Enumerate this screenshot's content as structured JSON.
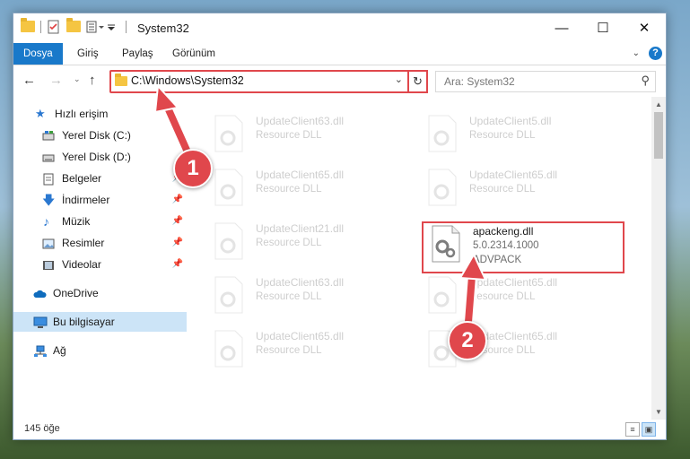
{
  "window": {
    "title": "System32",
    "controls": {
      "minimize": "—",
      "maximize": "☐",
      "close": "✕"
    }
  },
  "ribbon": {
    "tabs": [
      "Dosya",
      "Giriş",
      "Paylaş",
      "Görünüm"
    ],
    "expand_icon": "chevron-down-icon",
    "help_label": "?"
  },
  "navigation": {
    "address_path": "C:\\Windows\\System32",
    "search_placeholder": "Ara: System32"
  },
  "sidebar": {
    "items": [
      {
        "label": "Hızlı erişim",
        "icon": "star-icon"
      },
      {
        "label": "Yerel Disk (C:)",
        "icon": "drive-icon"
      },
      {
        "label": "Yerel Disk (D:)",
        "icon": "drive-icon"
      },
      {
        "label": "Belgeler",
        "icon": "documents-icon",
        "pinned": true
      },
      {
        "label": "İndirmeler",
        "icon": "download-icon",
        "pinned": true
      },
      {
        "label": "Müzik",
        "icon": "music-icon",
        "pinned": true
      },
      {
        "label": "Resimler",
        "icon": "pictures-icon",
        "pinned": true
      },
      {
        "label": "Videolar",
        "icon": "videos-icon",
        "pinned": true
      },
      {
        "label": "OneDrive",
        "icon": "cloud-icon"
      },
      {
        "label": "Bu bilgisayar",
        "icon": "computer-icon",
        "selected": true
      },
      {
        "label": "Ağ",
        "icon": "network-icon"
      }
    ]
  },
  "files": [
    {
      "name": "UpdateClient63.dll",
      "type": "Resource DLL",
      "faded": true
    },
    {
      "name": "UpdateClient5.dll",
      "type": "Resource DLL",
      "faded": true
    },
    {
      "name": "UpdateClient65.dll",
      "type": "Resource DLL",
      "faded": true
    },
    {
      "name": "UpdateClient65.dll",
      "type": "Resource DLL",
      "faded": true
    },
    {
      "name": "UpdateClient21.dll",
      "type": "Resource DLL",
      "faded": true
    },
    {
      "name": "apackeng.dll",
      "version": "5.0.2314.1000",
      "type": "ADVPACK",
      "faded": false
    },
    {
      "name": "UpdateClient63.dll",
      "type": "Resource DLL",
      "faded": true
    },
    {
      "name": "UpdateClient65.dll",
      "type": "Resource DLL",
      "faded": true
    },
    {
      "name": "UpdateClient65.dll",
      "type": "Resource DLL",
      "faded": true
    },
    {
      "name": "UpdateClient65.dll",
      "type": "Resource DLL",
      "faded": true
    }
  ],
  "status": {
    "item_count": "145 öğe"
  },
  "callouts": [
    "1",
    "2"
  ],
  "colors": {
    "accent": "#1979ca",
    "highlight": "#e0474c",
    "selected_bg": "#cce4f7"
  }
}
